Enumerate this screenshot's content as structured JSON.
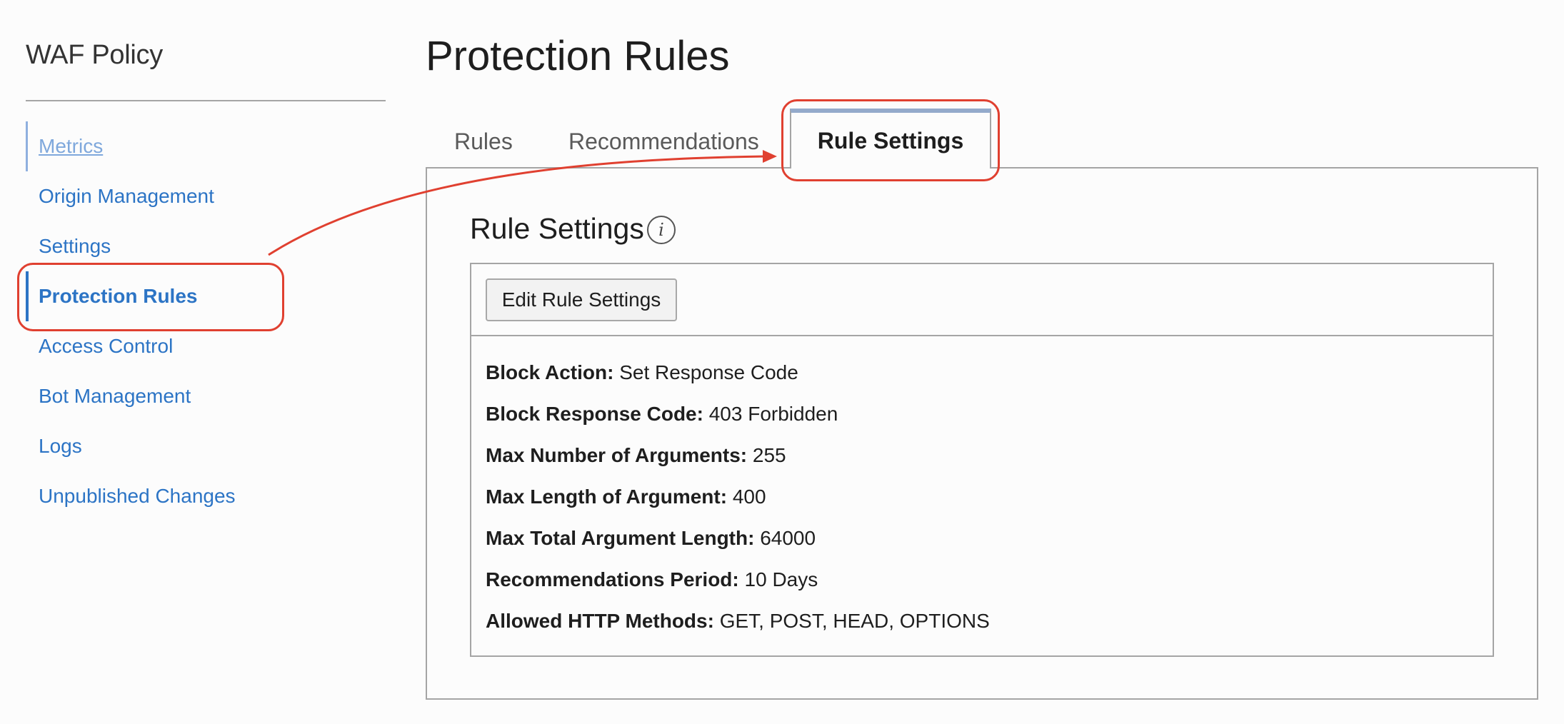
{
  "sidebar": {
    "title": "WAF Policy",
    "items": [
      {
        "label": "Metrics",
        "state": "visited"
      },
      {
        "label": "Origin Management",
        "state": "normal"
      },
      {
        "label": "Settings",
        "state": "normal"
      },
      {
        "label": "Protection Rules",
        "state": "active"
      },
      {
        "label": "Access Control",
        "state": "normal"
      },
      {
        "label": "Bot Management",
        "state": "normal"
      },
      {
        "label": "Logs",
        "state": "normal"
      },
      {
        "label": "Unpublished Changes",
        "state": "normal"
      }
    ]
  },
  "main": {
    "title": "Protection Rules",
    "tabs": [
      {
        "label": "Rules",
        "selected": false
      },
      {
        "label": "Recommendations",
        "selected": false
      },
      {
        "label": "Rule Settings",
        "selected": true
      }
    ],
    "section": {
      "title": "Rule Settings",
      "info_icon": "info-icon",
      "edit_button": "Edit Rule Settings",
      "rows": [
        {
          "label": "Block Action:",
          "value": "Set Response Code"
        },
        {
          "label": "Block Response Code:",
          "value": "403 Forbidden"
        },
        {
          "label": "Max Number of Arguments:",
          "value": "255"
        },
        {
          "label": "Max Length of Argument:",
          "value": "400"
        },
        {
          "label": "Max Total Argument Length:",
          "value": "64000"
        },
        {
          "label": "Recommendations Period:",
          "value": "10 Days"
        },
        {
          "label": "Allowed HTTP Methods:",
          "value": "GET, POST, HEAD, OPTIONS"
        }
      ]
    }
  },
  "colors": {
    "link": "#2c74c5",
    "link_visited": "#7fa8dc",
    "annotation": "#e04030",
    "active_tab_border": "#94aacb",
    "border": "#a5a5a5"
  }
}
